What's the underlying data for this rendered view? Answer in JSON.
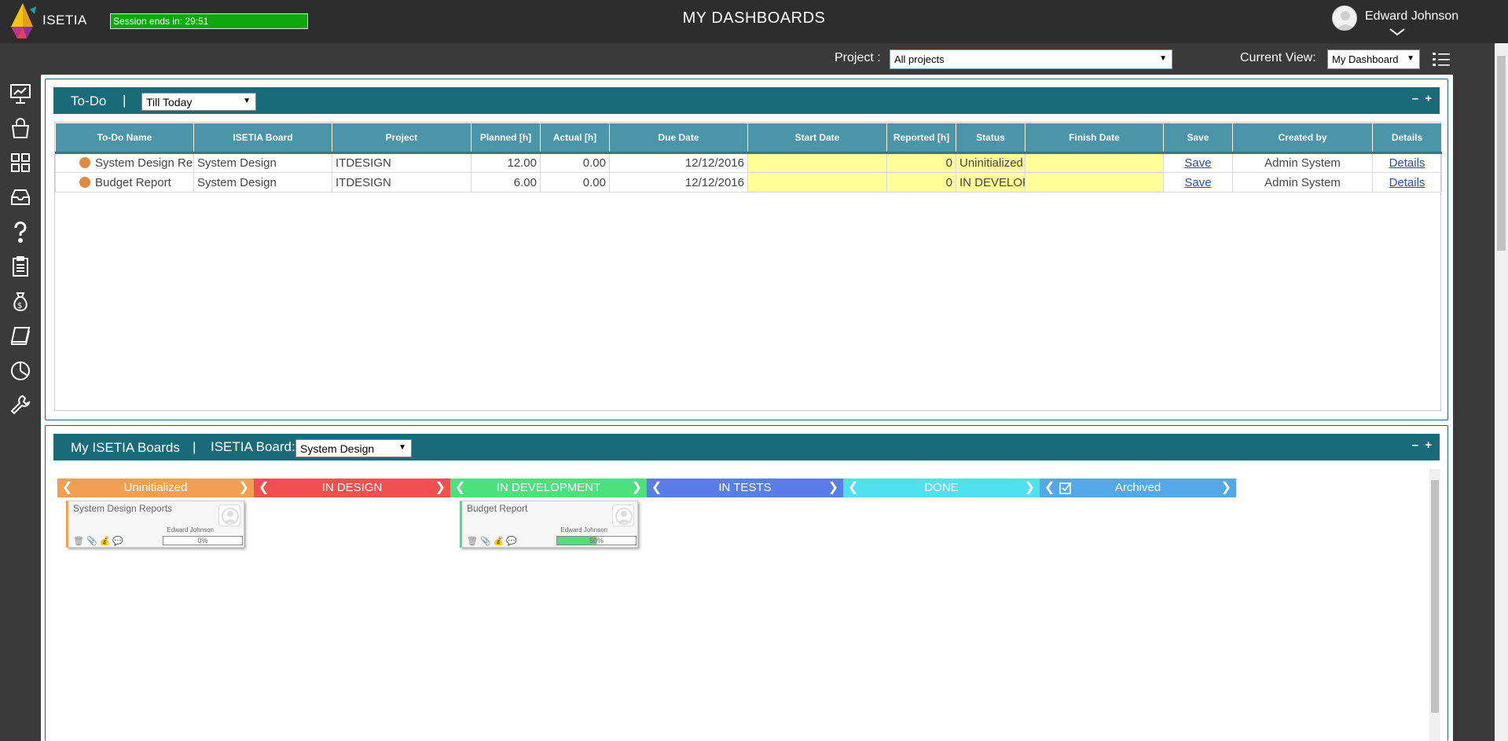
{
  "header": {
    "brand": "ISETIA",
    "session_text": "Session ends in: 29:51",
    "page_title": "MY DASHBOARDS",
    "user_name": "Edward Johnson"
  },
  "filters": {
    "project_label": "Project :",
    "project_value": "All projects",
    "view_label": "Current View:",
    "view_value": "My Dashboard"
  },
  "sidebar": {
    "icons": [
      "presentation-icon",
      "shopping-bag-icon",
      "grid-icon",
      "inbox-icon",
      "help-icon",
      "clipboard-icon",
      "money-bag-icon",
      "book-icon",
      "pie-chart-icon",
      "wrench-icon"
    ]
  },
  "todo": {
    "title": "To-Do",
    "separator": "|",
    "filter_value": "Till Today",
    "buttons": "– +",
    "columns": [
      "To-Do Name",
      "ISETIA Board",
      "Project",
      "Planned [h]",
      "Actual [h]",
      "Due Date",
      "Start Date",
      "Reported [h]",
      "Status",
      "Finish Date",
      "Save",
      "Created by",
      "Details"
    ],
    "rows": [
      {
        "name": "System Design Reports",
        "board": "System Design",
        "project": "ITDESIGN",
        "planned": "12.00",
        "actual": "0.00",
        "due": "12/12/2016",
        "start": "",
        "reported": "0",
        "status": "Uninitialized",
        "finish": "",
        "save": "Save",
        "created": "Admin System",
        "details": "Details"
      },
      {
        "name": "Budget Report",
        "board": "System Design",
        "project": "ITDESIGN",
        "planned": "6.00",
        "actual": "0.00",
        "due": "12/12/2016",
        "start": "",
        "reported": "0",
        "status": "IN DEVELOPMENT",
        "finish": "",
        "save": "Save",
        "created": "Admin System",
        "details": "Details"
      }
    ]
  },
  "boards": {
    "title": "My ISETIA Boards",
    "separator": "|",
    "board_label": "ISETIA Board:",
    "board_value": "System Design",
    "buttons": "– +",
    "columns": [
      {
        "label": "Uninitialized",
        "color": "#f0a050"
      },
      {
        "label": "IN DESIGN",
        "color": "#f05050"
      },
      {
        "label": "IN DEVELOPMENT",
        "color": "#4de07e"
      },
      {
        "label": "IN TESTS",
        "color": "#5a7ee8"
      },
      {
        "label": "DONE",
        "color": "#50e0ee"
      },
      {
        "label": "Archived",
        "color": "#55a8e8"
      }
    ],
    "cards": [
      {
        "title": "System Design Reports",
        "user": "Edward Johnson",
        "progress_text": "0%",
        "progress": 0,
        "accent": "#f0a050"
      },
      {
        "title": "Budget Report",
        "user": "Edward Johnson",
        "progress_text": "50%",
        "progress": 50,
        "accent": "#4de07e"
      }
    ]
  }
}
